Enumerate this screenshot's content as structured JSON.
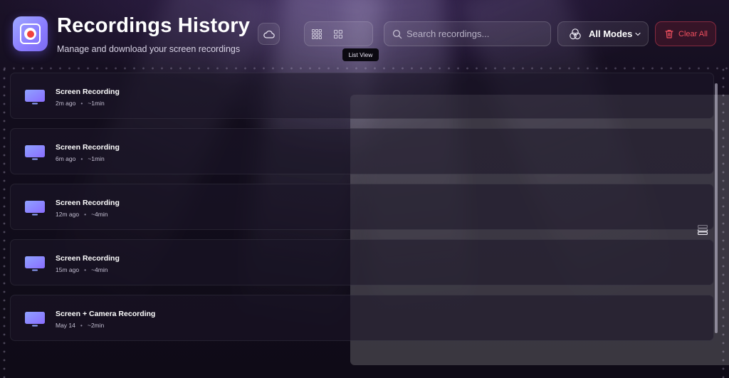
{
  "header": {
    "title": "Recordings History",
    "subtitle": "Manage and download your screen recordings",
    "cloud_icon": "cloud-icon",
    "view_toggle": {
      "options": [
        {
          "name": "large-grid",
          "icon": "grid-large-icon"
        },
        {
          "name": "small-grid",
          "icon": "grid-small-icon"
        },
        {
          "name": "list",
          "icon": "list-icon",
          "selected": true
        }
      ],
      "tooltip": "List View"
    },
    "search": {
      "placeholder": "Search recordings...",
      "value": ""
    },
    "modes": {
      "label": "All Modes",
      "icon": "modes-icon"
    },
    "clear_all": {
      "label": "Clear All",
      "icon": "trash-icon",
      "color": "#f0505f"
    }
  },
  "recordings": [
    {
      "title": "Screen Recording",
      "time": "2m ago",
      "duration": "~1min",
      "icon": "monitor-icon"
    },
    {
      "title": "Screen Recording",
      "time": "6m ago",
      "duration": "~1min",
      "icon": "monitor-icon"
    },
    {
      "title": "Screen Recording",
      "time": "12m ago",
      "duration": "~4min",
      "icon": "monitor-icon"
    },
    {
      "title": "Screen Recording",
      "time": "15m ago",
      "duration": "~4min",
      "icon": "monitor-icon"
    },
    {
      "title": "Screen + Camera Recording",
      "time": "May 14",
      "duration": "~2min",
      "icon": "monitor-icon"
    }
  ],
  "colors": {
    "accent": "#8a7bff",
    "record": "#f0423f",
    "background": "#0f0b18",
    "danger": "#f0505f"
  },
  "meta_separator": "•"
}
